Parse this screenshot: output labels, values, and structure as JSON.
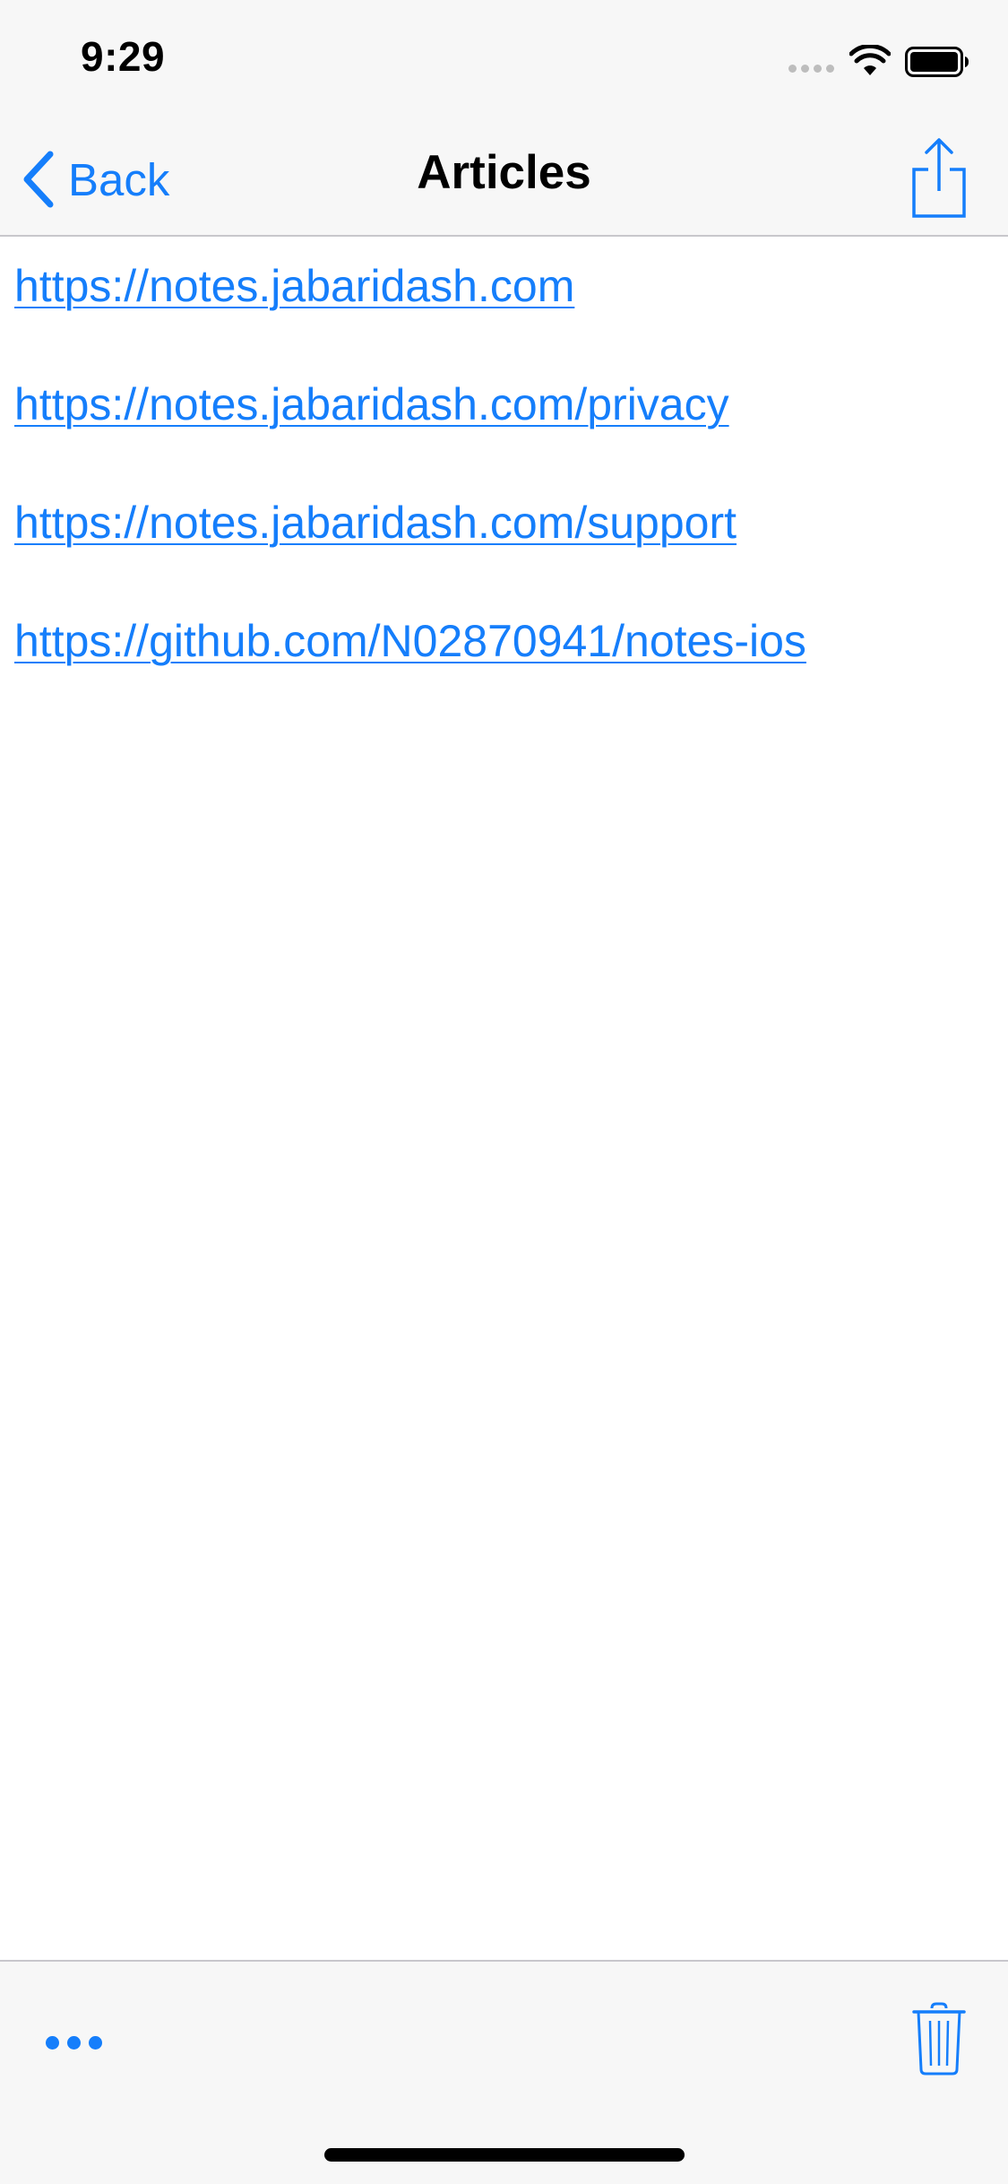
{
  "status_bar": {
    "time": "9:29"
  },
  "nav_bar": {
    "back_label": "Back",
    "title": "Articles",
    "share_icon": "share-icon"
  },
  "links": [
    "https://notes.jabaridash.com",
    "https://notes.jabaridash.com/privacy",
    "https://notes.jabaridash.com/support",
    "https://github.com/N02870941/notes-ios"
  ],
  "toolbar": {
    "more_icon": "ellipsis-icon",
    "trash_icon": "trash-icon"
  },
  "colors": {
    "accent": "#157efb",
    "bar_background": "#f7f7f7",
    "separator": "#c8c7cc"
  }
}
